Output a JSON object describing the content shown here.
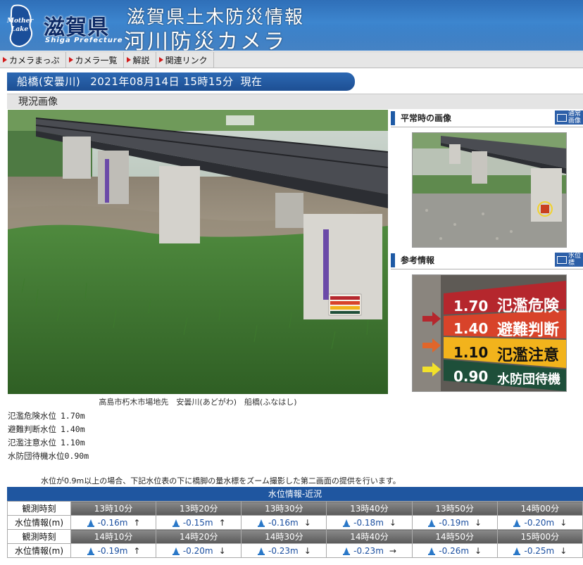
{
  "header": {
    "logo_text": "滋賀県",
    "logo_mark": "Mother Lake",
    "logo_sub": "Shiga Prefecture",
    "title_line1": "滋賀県土木防災情報",
    "title_line2": "河川防災カメラ"
  },
  "nav": [
    {
      "label": "カメラまっぷ"
    },
    {
      "label": "カメラ一覧"
    },
    {
      "label": "解説"
    },
    {
      "label": "関連リンク"
    }
  ],
  "station": {
    "name": "船橋(安曇川)",
    "date": "2021年08月14日 15時15分",
    "status": "現在"
  },
  "section_title": "現況画像",
  "main_caption": "高島市朽木市場地先　安曇川(あどがわ)　船橋(ふなはし)",
  "levels": [
    {
      "label": "氾濫危険水位",
      "value": "1.70m"
    },
    {
      "label": "避難判断水位",
      "value": "1.40m"
    },
    {
      "label": "氾濫注意水位",
      "value": "1.10m"
    },
    {
      "label": "水防団待機水位",
      "value": "0.90m"
    }
  ],
  "note": "水位が0.9m以上の場合、下記水位表の下に橋脚の量水標をズーム撮影した第二画面の提供を行います。",
  "right": {
    "normal_title": "平常時の画像",
    "normal_tag": "通常画像",
    "reference_title": "参考情報",
    "reference_tag": "水位標",
    "gauge": [
      {
        "value": "1.70",
        "label": "氾濫危険",
        "color": "#b5272d"
      },
      {
        "value": "1.40",
        "label": "避難判断",
        "color": "#d8432a"
      },
      {
        "value": "1.10",
        "label": "氾濫注意",
        "color": "#f2b31c"
      },
      {
        "value": "0.90",
        "label": "水防団待機",
        "color": "#1e4f3a"
      }
    ]
  },
  "water_table": {
    "title": "水位情報-近況",
    "time_label": "観測時刻",
    "level_label": "水位情報(m)",
    "rows": [
      {
        "times": [
          "13時10分",
          "13時20分",
          "13時30分",
          "13時40分",
          "13時50分",
          "14時00分"
        ],
        "values": [
          "-0.16m",
          "-0.15m",
          "-0.16m",
          "-0.18m",
          "-0.19m",
          "-0.20m"
        ],
        "trends": [
          "↑",
          "↑",
          "↓",
          "↓",
          "↓",
          "↓"
        ]
      },
      {
        "times": [
          "14時10分",
          "14時20分",
          "14時30分",
          "14時40分",
          "14時50分",
          "15時00分"
        ],
        "values": [
          "-0.19m",
          "-0.20m",
          "-0.23m",
          "-0.23m",
          "-0.26m",
          "-0.25m"
        ],
        "trends": [
          "↑",
          "↓",
          "↓",
          "→",
          "↓",
          "↓"
        ]
      }
    ]
  }
}
